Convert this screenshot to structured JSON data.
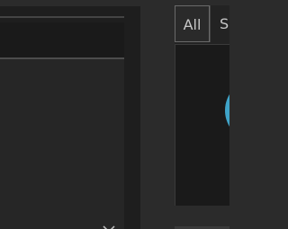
{
  "tabs": [
    {
      "label": "All",
      "active": true
    },
    {
      "label": "Se",
      "active": false
    }
  ],
  "icons": {
    "expand": "chevron-down-icon"
  },
  "colors": {
    "background": "#2b2b2b",
    "panel": "#1e1e1e",
    "accent_circle": "#3fa4c9",
    "tab_text": "#c8c8c8"
  }
}
